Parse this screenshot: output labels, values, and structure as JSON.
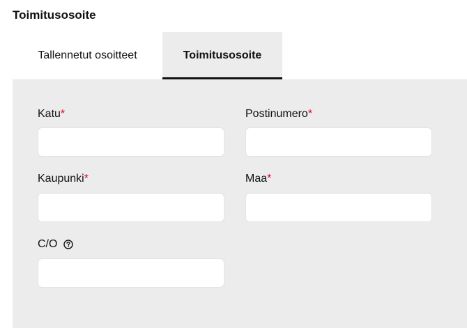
{
  "section": {
    "title": "Toimitusosoite"
  },
  "tabs": [
    {
      "label": "Tallennetut osoitteet",
      "active": false
    },
    {
      "label": "Toimitusosoite",
      "active": true
    }
  ],
  "form": {
    "street": {
      "label": "Katu",
      "required_mark": "*",
      "value": ""
    },
    "postal_code": {
      "label": "Postinumero",
      "required_mark": "*",
      "value": ""
    },
    "city": {
      "label": "Kaupunki",
      "required_mark": "*",
      "value": ""
    },
    "country": {
      "label": "Maa",
      "required_mark": "*",
      "value": ""
    },
    "care_of": {
      "label": "C/O",
      "help_icon": "help-circle-icon",
      "value": ""
    }
  },
  "colors": {
    "panel_bg": "#ececec",
    "required": "#e0001a",
    "active_tab_border": "#111111"
  }
}
